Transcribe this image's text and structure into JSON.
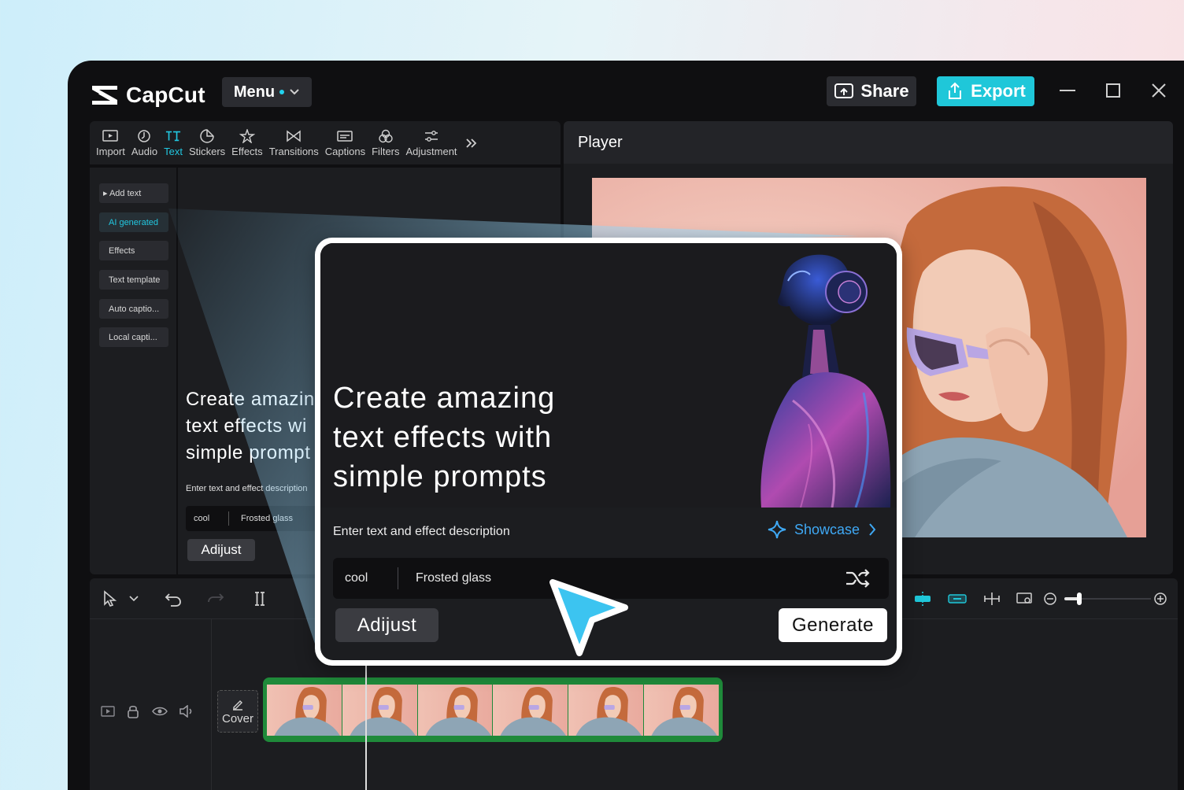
{
  "app": {
    "logo_text": "CapCut",
    "menu_label": "Menu",
    "share_label": "Share",
    "export_label": "Export",
    "accent_color": "#22c7e0",
    "export_color": "#1fc7d9"
  },
  "toolbar": {
    "items": [
      {
        "label": "Import",
        "icon": "import-icon"
      },
      {
        "label": "Audio",
        "icon": "audio-icon"
      },
      {
        "label": "Text",
        "icon": "text-icon",
        "active": true
      },
      {
        "label": "Stickers",
        "icon": "sticker-icon"
      },
      {
        "label": "Effects",
        "icon": "effects-icon"
      },
      {
        "label": "Transitions",
        "icon": "transitions-icon"
      },
      {
        "label": "Captions",
        "icon": "captions-icon"
      },
      {
        "label": "Filters",
        "icon": "filters-icon"
      },
      {
        "label": "Adjustment",
        "icon": "adjustment-icon"
      }
    ],
    "more_icon": "double-chevron-right-icon"
  },
  "sidebar": {
    "items": [
      {
        "label": "▸ Add text"
      },
      {
        "label": "AI generated",
        "active": true
      },
      {
        "label": "Effects"
      },
      {
        "label": "Text template"
      },
      {
        "label": "Auto captio..."
      },
      {
        "label": "Local capti..."
      }
    ]
  },
  "content_panel": {
    "headline_lines": [
      "Create amazin",
      "text effects wi",
      "simple prompt"
    ],
    "description": "Enter text and effect description",
    "input_value_1": "cool",
    "input_value_2": "Frosted glass",
    "adjust_label": "Adijust"
  },
  "player": {
    "title": "Player"
  },
  "timeline": {
    "cover_label": "Cover"
  },
  "popup": {
    "headline_lines": [
      "Create amazing",
      "text effects with",
      "simple prompts"
    ],
    "description": "Enter text and effect description",
    "showcase_label": "Showcase",
    "input_value_1": "cool",
    "input_value_2": "Frosted glass",
    "adjust_label": "Adijust",
    "generate_label": "Generate",
    "showcase_color": "#3fa9f5"
  }
}
